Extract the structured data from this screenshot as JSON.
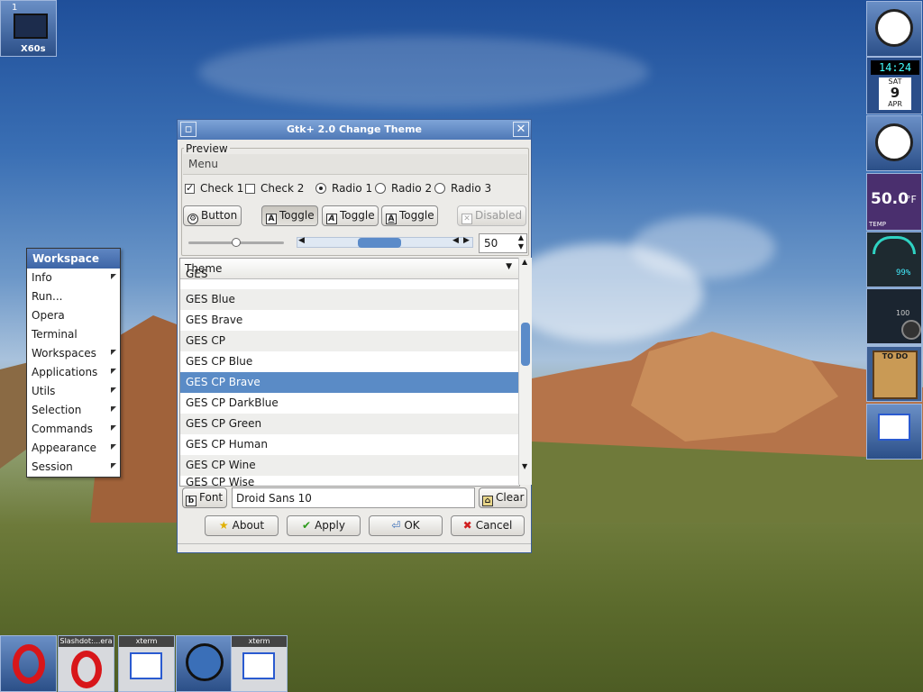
{
  "pager": {
    "number": "1",
    "label": "X60s"
  },
  "clock": {
    "time": "14:24",
    "day": "SAT",
    "date": "9",
    "month": "APR"
  },
  "temperature": {
    "value": "50.0",
    "unit": "°F",
    "caption": "TEMP"
  },
  "battery": {
    "percent": "99%"
  },
  "volume": {
    "level": "100"
  },
  "todo": {
    "label": "TO DO"
  },
  "workspace_menu": {
    "title": "Workspace",
    "items": [
      {
        "label": "Info",
        "submenu": true
      },
      {
        "label": "Run...",
        "submenu": false
      },
      {
        "label": "Opera",
        "submenu": false
      },
      {
        "label": "Terminal",
        "submenu": false
      },
      {
        "label": "Workspaces",
        "submenu": true
      },
      {
        "label": "Applications",
        "submenu": true
      },
      {
        "label": "Utils",
        "submenu": true
      },
      {
        "label": "Selection",
        "submenu": true
      },
      {
        "label": "Commands",
        "submenu": true
      },
      {
        "label": "Appearance",
        "submenu": true
      },
      {
        "label": "Session",
        "submenu": true
      }
    ]
  },
  "window": {
    "title": "Gtk+ 2.0 Change Theme",
    "preview_label": "Preview",
    "menu_label": "Menu",
    "check1": "Check 1",
    "check2": "Check 2",
    "radio1": "Radio 1",
    "radio2": "Radio 2",
    "radio3": "Radio 3",
    "button": "Button",
    "toggle": "Toggle",
    "disabled": "Disabled",
    "spin_value": "50",
    "slider_level": 0.5,
    "theme_header": "Theme",
    "themes": [
      "GES",
      "GES Blue",
      "GES Brave",
      "GES CP",
      "GES CP Blue",
      "GES CP Brave",
      "GES CP DarkBlue",
      "GES CP Green",
      "GES CP Human",
      "GES CP Wine",
      "GES CP Wise"
    ],
    "selected_theme": "GES CP Brave",
    "font_button": "Font",
    "font_value": "Droid Sans 10",
    "clear": "Clear",
    "about": "About",
    "apply": "Apply",
    "ok": "OK",
    "cancel": "Cancel"
  },
  "taskbar": {
    "slashdot": "Slashdot:...era",
    "xterm1": "xterm",
    "xterm2": "xterm"
  }
}
